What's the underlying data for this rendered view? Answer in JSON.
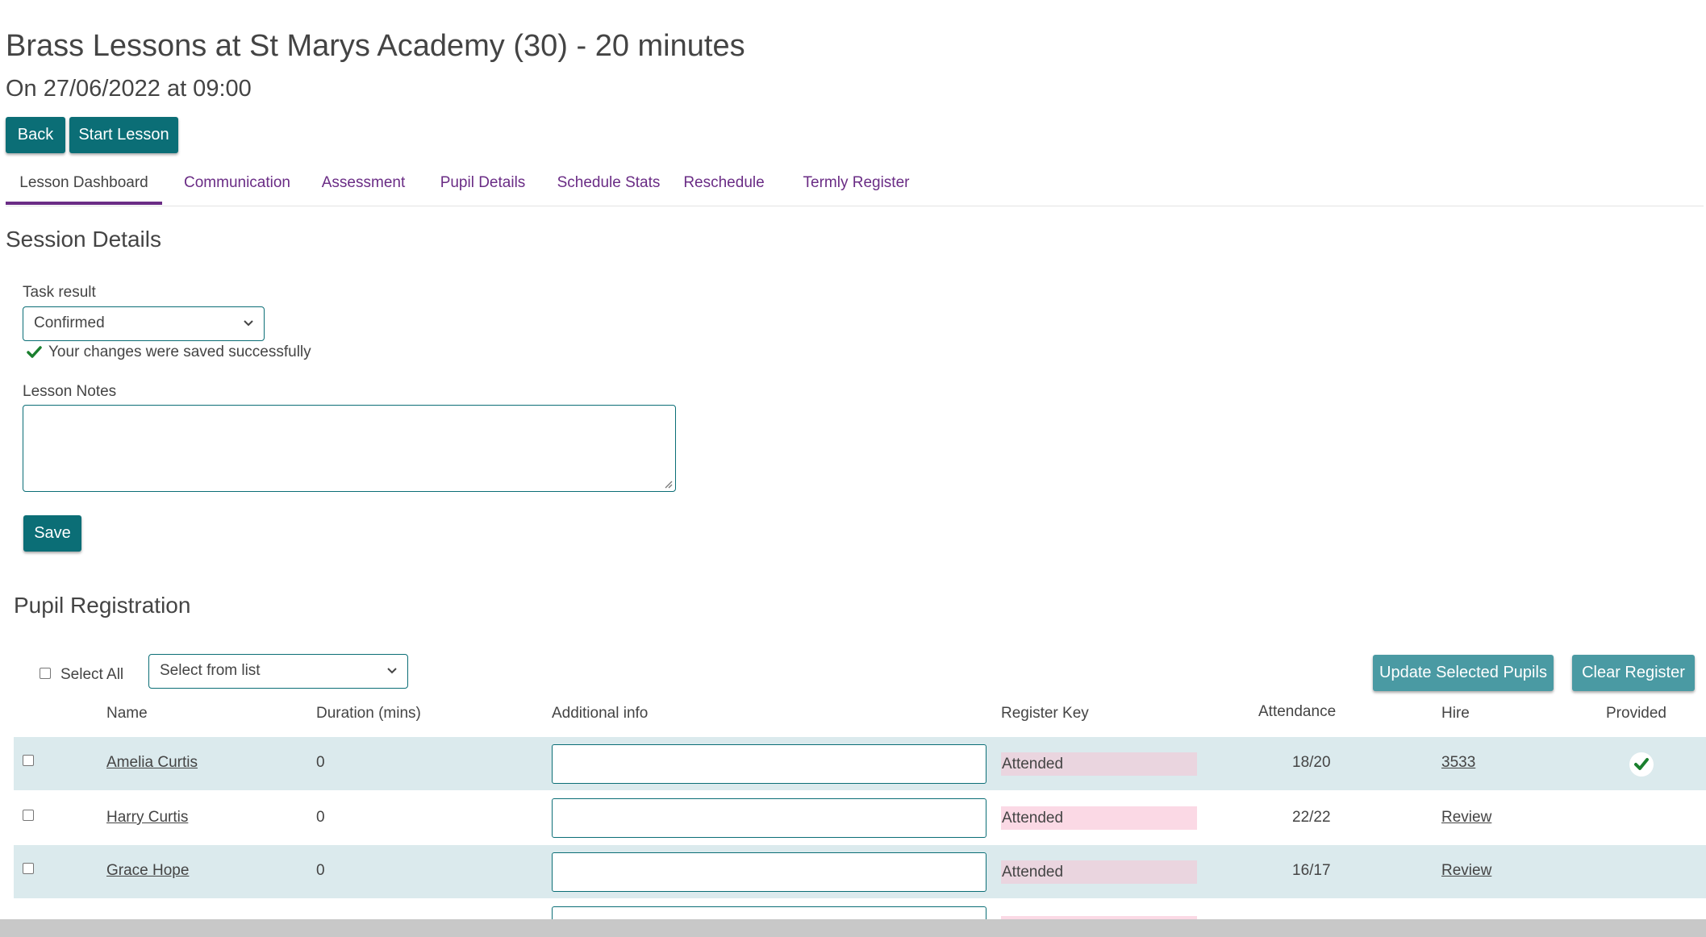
{
  "header": {
    "title": "Brass Lessons at St Marys Academy (30) - 20 minutes",
    "subtitle": "On 27/06/2022 at 09:00"
  },
  "actions": {
    "back_label": "Back",
    "start_label": "Start Lesson"
  },
  "tabs": [
    {
      "label": "Lesson Dashboard",
      "active": true
    },
    {
      "label": "Communication",
      "active": false
    },
    {
      "label": "Assessment",
      "active": false
    },
    {
      "label": "Pupil Details",
      "active": false
    },
    {
      "label": "Schedule Stats",
      "active": false
    },
    {
      "label": "Reschedule",
      "active": false
    },
    {
      "label": "Termly Register",
      "active": false
    }
  ],
  "session": {
    "title": "Session Details",
    "task_result_label": "Task result",
    "task_result_value": "Confirmed",
    "success_message": "Your changes were saved successfully",
    "notes_label": "Lesson Notes",
    "notes_value": "",
    "save_label": "Save"
  },
  "registration": {
    "title": "Pupil Registration",
    "select_all_label": "Select All",
    "bulk_select_placeholder": "Select from list",
    "update_label": "Update Selected Pupils",
    "clear_label": "Clear Register",
    "columns": {
      "name": "Name",
      "duration": "Duration (mins)",
      "info": "Additional info",
      "key": "Register Key",
      "attendance": "Attendance",
      "hire": "Hire",
      "provided": "Provided"
    },
    "rows": [
      {
        "name": "Amelia Curtis",
        "duration": "0",
        "info": "",
        "key": "Attended",
        "attendance": "18/20",
        "hire": "3533",
        "provided": true
      },
      {
        "name": "Harry Curtis",
        "duration": "0",
        "info": "",
        "key": "Attended",
        "attendance": "22/22",
        "hire": "Review",
        "provided": false
      },
      {
        "name": "Grace Hope",
        "duration": "0",
        "info": "",
        "key": "Attended",
        "attendance": "16/17",
        "hire": "Review",
        "provided": false
      }
    ]
  },
  "colors": {
    "primary_button": "#0b6e76",
    "secondary_button": "#4a9aa3",
    "tab_accent": "#6a2c85",
    "row_shade": "#dbeaed",
    "register_key_bg": "#fbd9e5",
    "success_check": "#1a7f2e"
  }
}
